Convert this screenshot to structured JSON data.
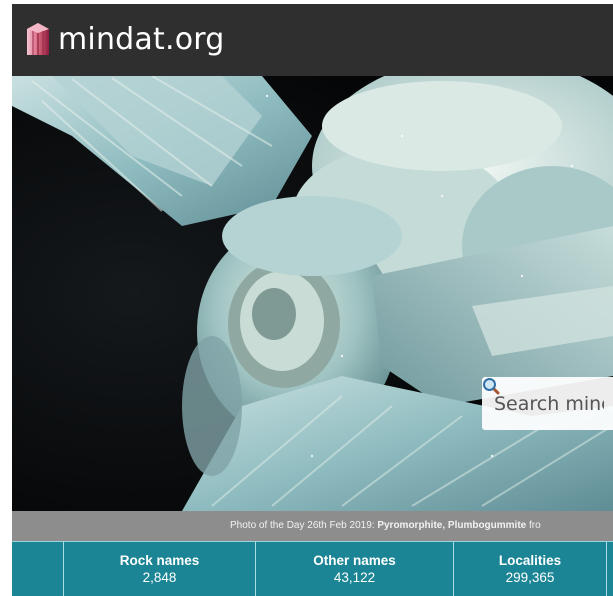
{
  "site": {
    "name": "mindat.org"
  },
  "search": {
    "placeholder": "Search minerals"
  },
  "photo_of_the_day": {
    "prefix": "Photo of the Day 26th Feb 2019: ",
    "title": "Pyromorphite, Plumbogummite",
    "suffix": " fro"
  },
  "stats": [
    {
      "label": "",
      "value": ""
    },
    {
      "label": "Rock names",
      "value": "2,848"
    },
    {
      "label": "Other names",
      "value": "43,122"
    },
    {
      "label": "Localities",
      "value": "299,365"
    },
    {
      "label": "",
      "value": ""
    }
  ],
  "colors": {
    "header_bg": "#2f2f2f",
    "stats_bg": "#1b8595",
    "caption_bg": "#8d8d8d"
  },
  "icons": {
    "logo": "crystal-logo-icon",
    "search": "magnifier-icon"
  }
}
